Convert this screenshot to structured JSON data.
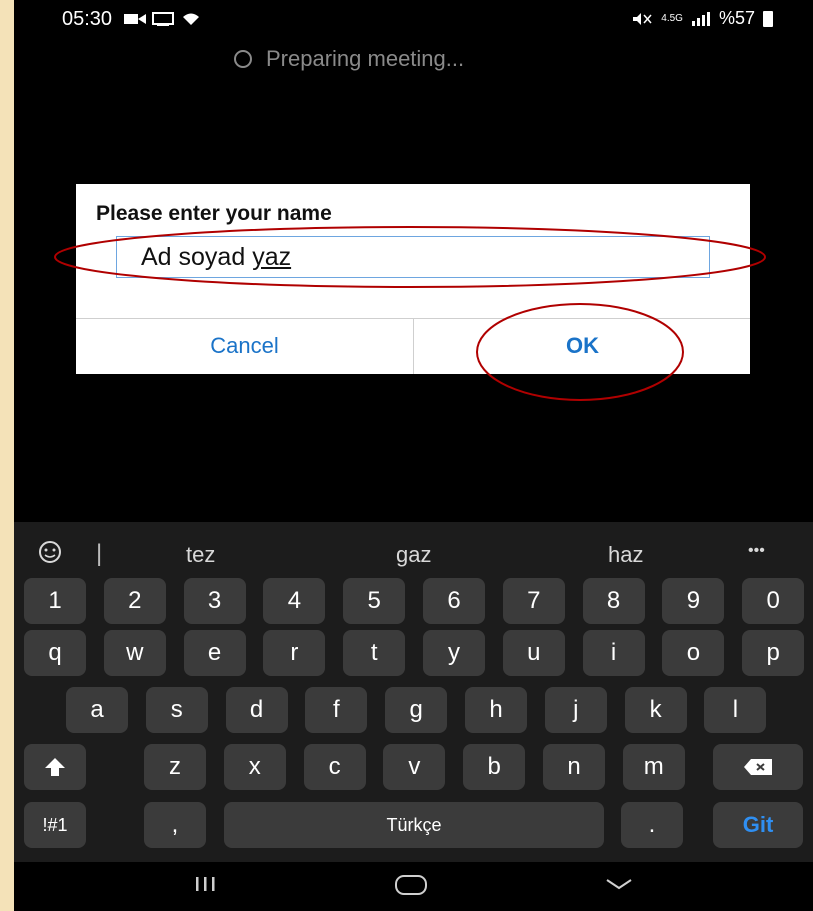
{
  "status_bar": {
    "time": "05:30",
    "battery_text": "%57",
    "network_label": "4.5G"
  },
  "preparing_text": "Preparing meeting...",
  "dialog": {
    "title": "Please enter your name",
    "input_value_part1": "Ad soyad ",
    "input_value_part2": "yaz",
    "cancel_label": "Cancel",
    "ok_label": "OK"
  },
  "keyboard": {
    "suggestions": [
      "tez",
      "gaz",
      "haz"
    ],
    "more_label": "•••",
    "digits": [
      "1",
      "2",
      "3",
      "4",
      "5",
      "6",
      "7",
      "8",
      "9",
      "0"
    ],
    "row1": [
      "q",
      "w",
      "e",
      "r",
      "t",
      "y",
      "u",
      "i",
      "o",
      "p"
    ],
    "row2": [
      "a",
      "s",
      "d",
      "f",
      "g",
      "h",
      "j",
      "k",
      "l"
    ],
    "row3": [
      "z",
      "x",
      "c",
      "v",
      "b",
      "n",
      "m"
    ],
    "symbols_label": "!#1",
    "comma_label": ",",
    "space_label": "Türkçe",
    "period_label": ".",
    "action_label": "Git"
  },
  "colors": {
    "accent": "#1a73c8",
    "annotation": "#b00000",
    "keyboard_bg": "#1c1c1c",
    "key_bg": "#3b3b3b"
  }
}
